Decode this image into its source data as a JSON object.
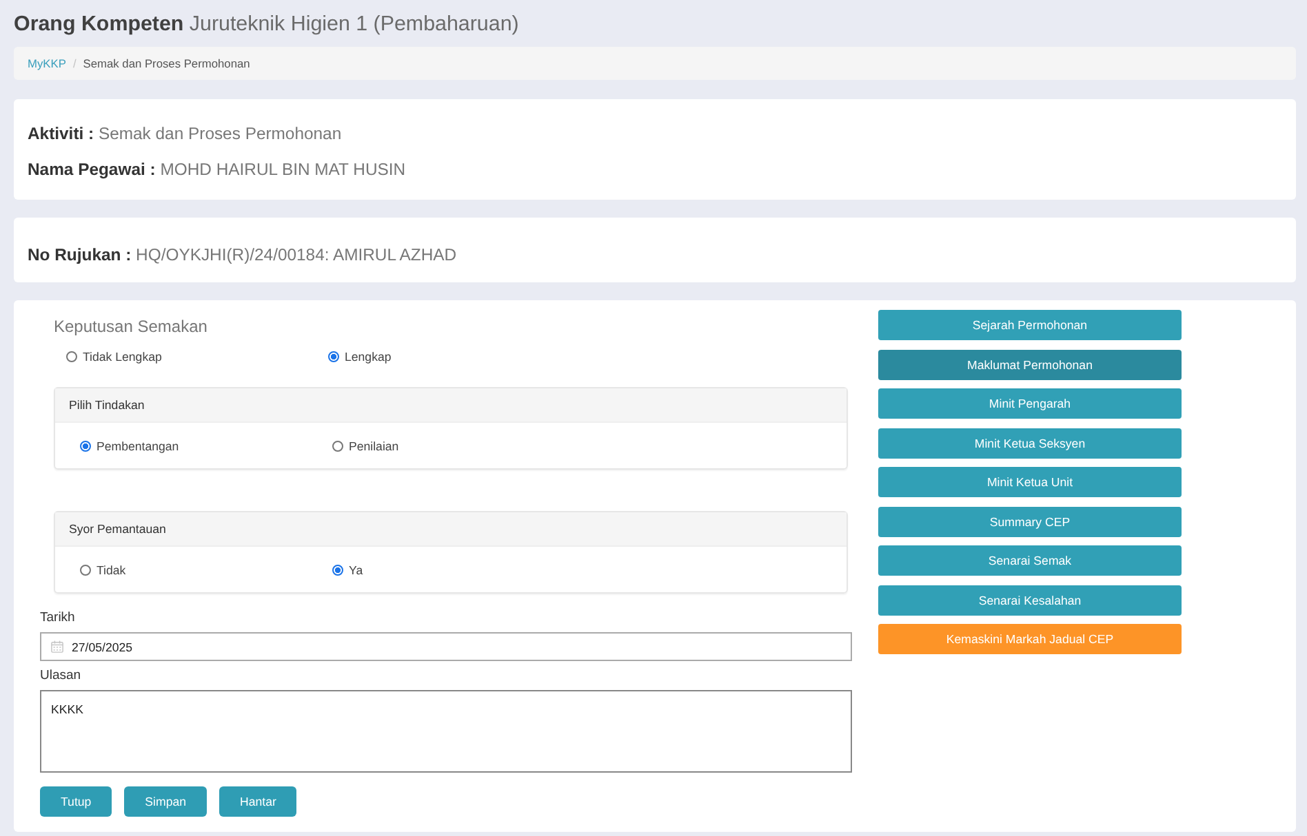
{
  "header": {
    "title": "**Orang Kompeten** Juruteknik Higien 1 (Pembaharuan)"
  },
  "breadcrumb": {
    "separator": "/",
    "items": [
      {
        "label": "MyKKP",
        "kind": "link"
      },
      {
        "label": "Semak dan Proses Permohonan",
        "kind": "current"
      }
    ]
  },
  "info_card": {
    "lines": [
      "**Aktiviti :** Semak dan Proses Permohonan",
      "**Nama Pegawai :** MOHD HAIRUL BIN MAT HUSIN"
    ]
  },
  "reference_card": {
    "lines": [
      "**No Rujukan :** HQ/OYKJHI(R)/24/00184: AMIRUL AZHAD"
    ]
  },
  "form": {
    "decision": {
      "label": "Keputusan Semakan",
      "options": [
        {
          "label": "Tidak Lengkap",
          "selected": false
        },
        {
          "label": "Lengkap",
          "selected": true
        }
      ]
    },
    "panels": [
      {
        "title": "Pilih Tindakan",
        "options": [
          {
            "label": "Pembentangan",
            "selected": true
          },
          {
            "label": "Penilaian",
            "selected": false
          }
        ]
      },
      {
        "title": "Syor Pemantauan",
        "options": [
          {
            "label": "Tidak",
            "selected": false
          },
          {
            "label": "Ya",
            "selected": true
          }
        ]
      }
    ],
    "date": {
      "label": "Tarikh",
      "value": "27/05/2025"
    },
    "remarks": {
      "label": "Ulasan",
      "value": "KKKK"
    },
    "buttons": [
      "Tutup",
      "Simpan",
      "Hantar"
    ]
  },
  "side_buttons": [
    {
      "label": "Sejarah Permohonan",
      "kind": "info",
      "selected": false
    },
    {
      "label": "Maklumat Permohonan",
      "kind": "info",
      "selected": true
    },
    {
      "label": "Minit Pengarah",
      "kind": "info",
      "selected": false
    },
    {
      "label": "Minit Ketua Seksyen",
      "kind": "info",
      "selected": false
    },
    {
      "label": "Minit Ketua Unit",
      "kind": "info",
      "selected": false
    },
    {
      "label": "Summary CEP",
      "kind": "info",
      "selected": false
    },
    {
      "label": "Senarai Semak",
      "kind": "info",
      "selected": false
    },
    {
      "label": "Senarai Kesalahan",
      "kind": "info",
      "selected": false
    },
    {
      "label": "Kemaskini Markah Jadual CEP",
      "kind": "warning",
      "selected": false
    }
  ]
}
